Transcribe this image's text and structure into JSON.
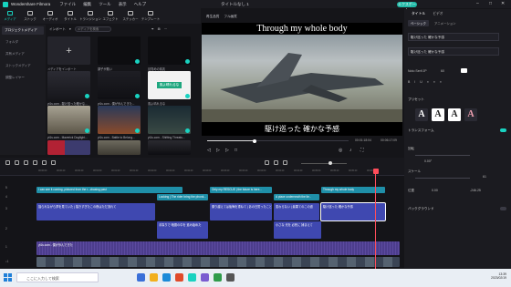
{
  "titlebar": {
    "app_name": "Wondershare Filmora",
    "menu": [
      "ファイル",
      "編集",
      "ツール",
      "表示",
      "ヘルプ"
    ],
    "doc_title": "タイトルなし 1",
    "export_label": "エクスポート"
  },
  "toolbar": {
    "items": [
      "メディア",
      "ストック",
      "オーディオ",
      "タイトル",
      "トランジション",
      "エフェクト",
      "ステッカー",
      "テンプレート"
    ]
  },
  "sidebar": {
    "project": "プロジェクトメディア",
    "items": [
      "フォルダ",
      "共有メディア",
      "ストックメディア",
      "調整レイヤー"
    ]
  },
  "media": {
    "import_label": "インポート",
    "search_placeholder": "メディアを検索",
    "tiles": [
      {
        "caption": "メディアをインポート"
      },
      {
        "caption": "調子が悪い"
      },
      {
        "caption": "目覚めの前兆"
      },
      {
        "caption": "yt1s.com - 駆け巡った確かな..."
      },
      {
        "caption": "yt1s.com - 僕が歩んできた..."
      },
      {
        "caption": "風よ晴れるな"
      },
      {
        "caption": "yt1s.com - Maverick Dogfight..."
      },
      {
        "caption": "yt1s.com - Battle to Belong..."
      },
      {
        "caption": "yt1s.com - Shifting Threats..."
      },
      {
        "caption": ""
      },
      {
        "caption": ""
      },
      {
        "caption": ""
      }
    ],
    "highlight_tile_text": "風よ晴れるな"
  },
  "preview": {
    "mode": "再生品質",
    "quality": "フル画質",
    "subtitle_top": "Through my whole body",
    "subtitle_bottom": "駆け巡った 確かな予感",
    "time_current": "00:01:18:04",
    "time_total": "00:06:17:09"
  },
  "right_panel": {
    "tabs": [
      "タイトル",
      "ビデオ"
    ],
    "subtabs": [
      "ベーシック",
      "アニメーション"
    ],
    "text_value": "駆け巡った 確かな予感",
    "font": "Noto Serif JP",
    "font_size": "60",
    "presets_label": "プリセット",
    "preset_letters": [
      "A",
      "A",
      "A",
      "A"
    ],
    "transform_label": "トランスフォーム",
    "rotate_label": "回転",
    "rotate_value": "0.00°",
    "scale_label": "スケール",
    "scale_value": "61",
    "position_label": "位置",
    "x_value": "0.00",
    "y_value": "-246.25",
    "background_label": "バックグラウンド"
  },
  "timeline": {
    "ruler": [
      "00:00:00",
      "00:00:20",
      "00:00:40",
      "00:01:00",
      "00:01:20",
      "00:01:40",
      "00:02:00",
      "00:02:20",
      "00:02:40",
      "00:03:00",
      "00:03:20",
      "00:03:40",
      "00:04:00",
      "00:04:20",
      "00:04:40",
      "00:05:00",
      "00:05:20",
      "00:05:40",
      "00:06:00"
    ],
    "track_labels": [
      "5",
      "4",
      "3",
      "2",
      "1",
      "♪1"
    ],
    "title_clips": [
      "I can see it coming, pictured from the r...chasing past",
      "Looking | The rider bring the phonk...",
      "Only my RESCUE | the future is here...",
      "A place underneath the lie..",
      "Through my whole body"
    ],
    "sub_clips_a": [
      "揺られながら夢を見ていた | 描きすぎたこの夜はただ流れて",
      "乗り越えては後悔を重ねて | あの日誓ったこと",
      "変わらない | 最果てのこの道",
      "駆け巡った 確かな予感"
    ],
    "sub_clips_b": [
      "手探りで 暗闇の中を 進み始めた",
      "小さな 光を 必死に 捕まえて"
    ],
    "audio_label": "yt1s.com - 僕が歩んできた"
  },
  "taskbar": {
    "search_placeholder": "ここに入力して検索",
    "time": "13:39",
    "date": "2023/02/19"
  },
  "colors": {
    "accent": "#19d2c0",
    "title_clip": "#1f8fa8",
    "subtitle_clip": "#3f48b0",
    "audio_clip": "#4c3d8c",
    "playhead": "#ff4d5a"
  }
}
